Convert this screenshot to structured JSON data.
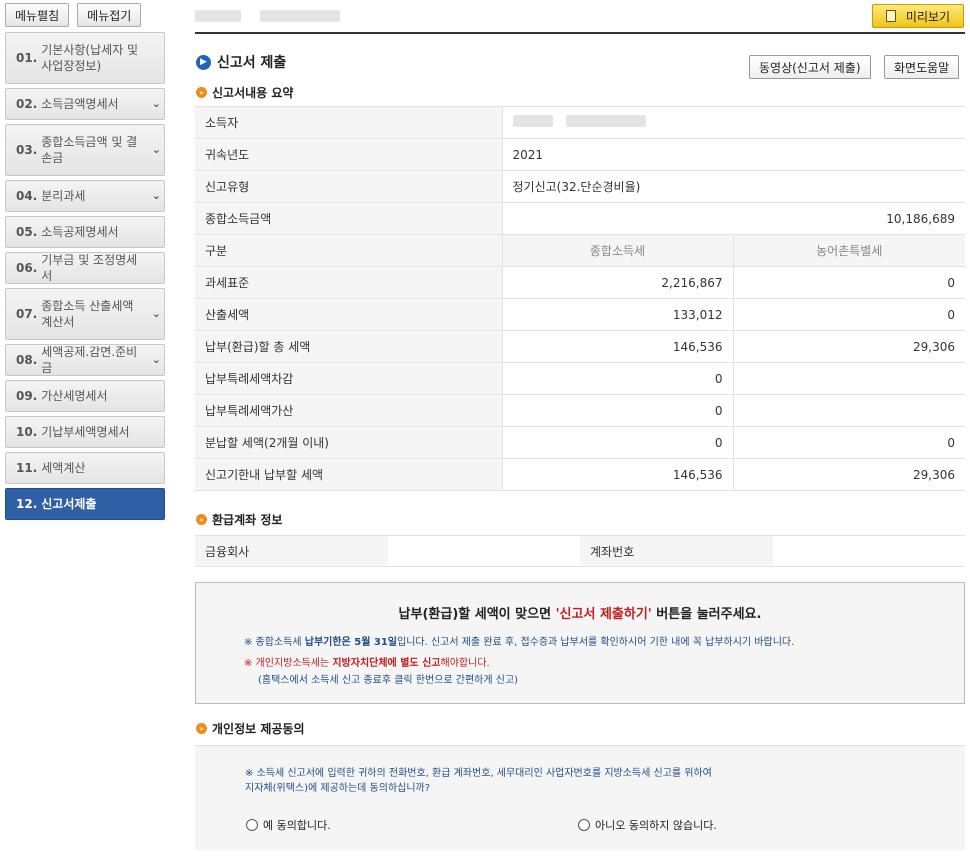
{
  "sidebar": {
    "expand_label": "메뉴펼침",
    "collapse_label": "메뉴접기",
    "items": [
      {
        "num": "01.",
        "label": "기본사항(납세자 및 사업장정보)",
        "chevron": false
      },
      {
        "num": "02.",
        "label": "소득금액명세서",
        "chevron": true
      },
      {
        "num": "03.",
        "label": "종합소득금액 및 결손금",
        "chevron": true
      },
      {
        "num": "04.",
        "label": "분리과세",
        "chevron": true
      },
      {
        "num": "05.",
        "label": "소득공제명세서",
        "chevron": false
      },
      {
        "num": "06.",
        "label": "기부금 및 조정명세서",
        "chevron": false
      },
      {
        "num": "07.",
        "label": "종합소득 산출세액계산서",
        "chevron": true
      },
      {
        "num": "08.",
        "label": "세액공제.감면.준비금",
        "chevron": true
      },
      {
        "num": "09.",
        "label": "가산세명세서",
        "chevron": false
      },
      {
        "num": "10.",
        "label": "기납부세액명세서",
        "chevron": false
      },
      {
        "num": "11.",
        "label": "세액계산",
        "chevron": false
      },
      {
        "num": "12.",
        "label": "신고서제출",
        "chevron": false
      }
    ]
  },
  "header": {
    "preview_label": "미리보기"
  },
  "main": {
    "title": "신고서 제출",
    "video_button": "동영상(신고서 제출)",
    "help_button": "화면도움말",
    "summary_section": "신고서내용 요약",
    "summary": {
      "taxpayer_label": "소득자",
      "year_label": "귀속년도",
      "year_value": "2021",
      "type_label": "신고유형",
      "type_value": "정기신고(32.단순경비율)",
      "total_income_label": "종합소득금액",
      "total_income_value": "10,186,689",
      "col_label": "구분",
      "col_income_tax": "종합소득세",
      "col_rural_tax": "농어촌특별세",
      "rows": [
        {
          "label": "과세표준",
          "income": "2,216,867",
          "rural": "0"
        },
        {
          "label": "산출세액",
          "income": "133,012",
          "rural": "0"
        },
        {
          "label": "납부(환급)할 총 세액",
          "income": "146,536",
          "rural": "29,306"
        },
        {
          "label": "납부특례세액차감",
          "income": "0",
          "rural": ""
        },
        {
          "label": "납부특례세액가산",
          "income": "0",
          "rural": ""
        },
        {
          "label": "분납할 세액(2개월 이내)",
          "income": "0",
          "rural": "0"
        },
        {
          "label": "신고기한내 납부할 세액",
          "income": "146,536",
          "rural": "29,306"
        }
      ]
    },
    "refund_section": "환급계좌 정보",
    "bank_label": "금융회사",
    "account_label": "계좌번호",
    "notice": {
      "main_prefix": "납부(환급)할 세액이 맞으면 ",
      "main_highlight": "'신고서 제출하기'",
      "main_suffix": " 버튼을 눌러주세요.",
      "l1_a": "※ 종합소득세 ",
      "l1_b": "납부기한은 5월 31일",
      "l1_c": "입니다. 신고서 제출 완료 후, 접수증과 납부서를 확인하시어 기한 내에 꼭 납부하시기 바랍니다.",
      "l2_a": "※ 개인지방소득세는 ",
      "l2_b": "지방자치단체에 별도 신고",
      "l2_c": "해야합니다.",
      "l3": "(홈택스에서 소득세 신고 종료후 클릭 한번으로 간편하게 신고)"
    },
    "consent_section": "개인정보 제공동의",
    "consent": {
      "q1": "※ 소득세 신고서에 입력한 귀하의 전화번호, 환급 계좌번호, 세무대리인 사업자번호를 지방소득세 신고를 위하여",
      "q2": "지자체(위택스)에 제공하는데 동의하십니까?",
      "yes": "예 동의합니다.",
      "no": "아니오 동의하지 않습니다."
    }
  }
}
